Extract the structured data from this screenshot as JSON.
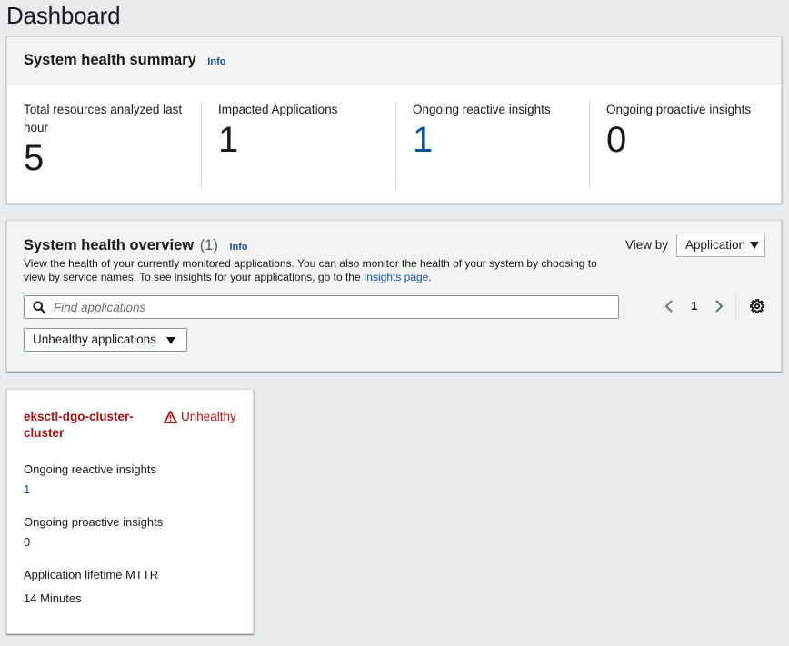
{
  "page": {
    "title": "Dashboard"
  },
  "summary": {
    "title": "System health summary",
    "info_label": "Info",
    "metrics": [
      {
        "label": "Total resources analyzed last hour",
        "value": "5",
        "is_link": false
      },
      {
        "label": "Impacted Applications",
        "value": "1",
        "is_link": false
      },
      {
        "label": "Ongoing reactive insights",
        "value": "1",
        "is_link": true
      },
      {
        "label": "Ongoing proactive insights",
        "value": "0",
        "is_link": false
      }
    ]
  },
  "overview": {
    "title": "System health overview",
    "count": "(1)",
    "info_label": "Info",
    "description_prefix": "View the health of your currently monitored applications. You can also monitor the health of your system by choosing to view by service names. To see insights for your applications, go to the ",
    "description_link": "Insights page",
    "description_suffix": ".",
    "view_by_label": "View by",
    "view_by_value": "Application",
    "search_placeholder": "Find applications",
    "search_value": "",
    "filter_value": "Unhealthy applications",
    "pagination": {
      "current_page": "1"
    },
    "icons": {
      "search": "search-icon",
      "prev": "chevron-left-icon",
      "next": "chevron-right-icon",
      "settings": "gear-icon",
      "dropdown": "caret-down-icon"
    }
  },
  "applications": [
    {
      "name": "eksctl-dgo-cluster-cluster",
      "status": "Unhealthy",
      "status_icon": "warning-icon",
      "fields": [
        {
          "label": "Ongoing reactive insights",
          "value": "1",
          "is_link": true
        },
        {
          "label": "Ongoing proactive insights",
          "value": "0",
          "is_link": false
        },
        {
          "label": "Application lifetime MTTR",
          "value": "14 Minutes",
          "is_link": false
        }
      ]
    }
  ],
  "colors": {
    "link": "#0a4d9a",
    "danger": "#b3131b",
    "app_name": "#a01818",
    "page_background": "#e9ebed",
    "card_header": "#f2f3f3"
  }
}
